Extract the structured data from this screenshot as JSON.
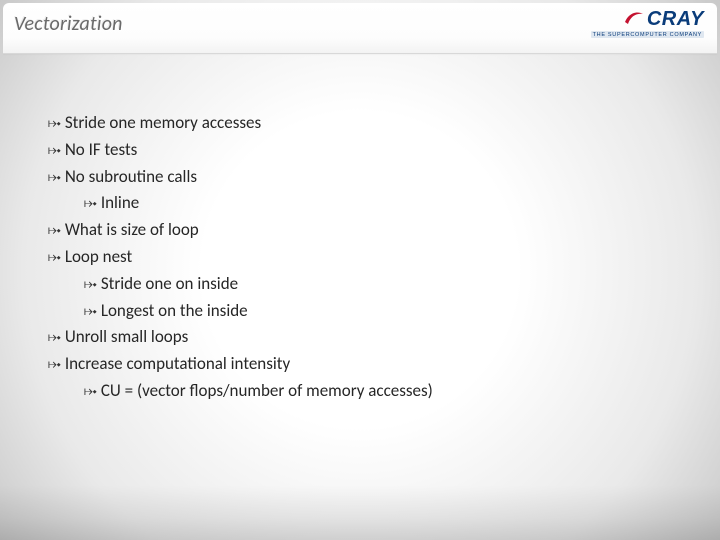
{
  "title": "Vectorization",
  "logo": {
    "text": "CRAY",
    "tagline": "THE SUPERCOMPUTER COMPANY"
  },
  "bullet_glyph": "⤠",
  "outline": [
    {
      "level": 1,
      "text": "Stride one memory accesses"
    },
    {
      "level": 1,
      "text": "No IF tests"
    },
    {
      "level": 1,
      "text": "No subroutine calls"
    },
    {
      "level": 2,
      "text": "Inline"
    },
    {
      "level": 1,
      "text": "What is size of loop"
    },
    {
      "level": 1,
      "text": "Loop nest"
    },
    {
      "level": 2,
      "text": "Stride one on inside"
    },
    {
      "level": 2,
      "text": "Longest on the inside"
    },
    {
      "level": 1,
      "text": "Unroll small loops"
    },
    {
      "level": 1,
      "text": "Increase computational intensity"
    },
    {
      "level": 2,
      "text": "CU = (vector flops/number of memory accesses)"
    }
  ]
}
